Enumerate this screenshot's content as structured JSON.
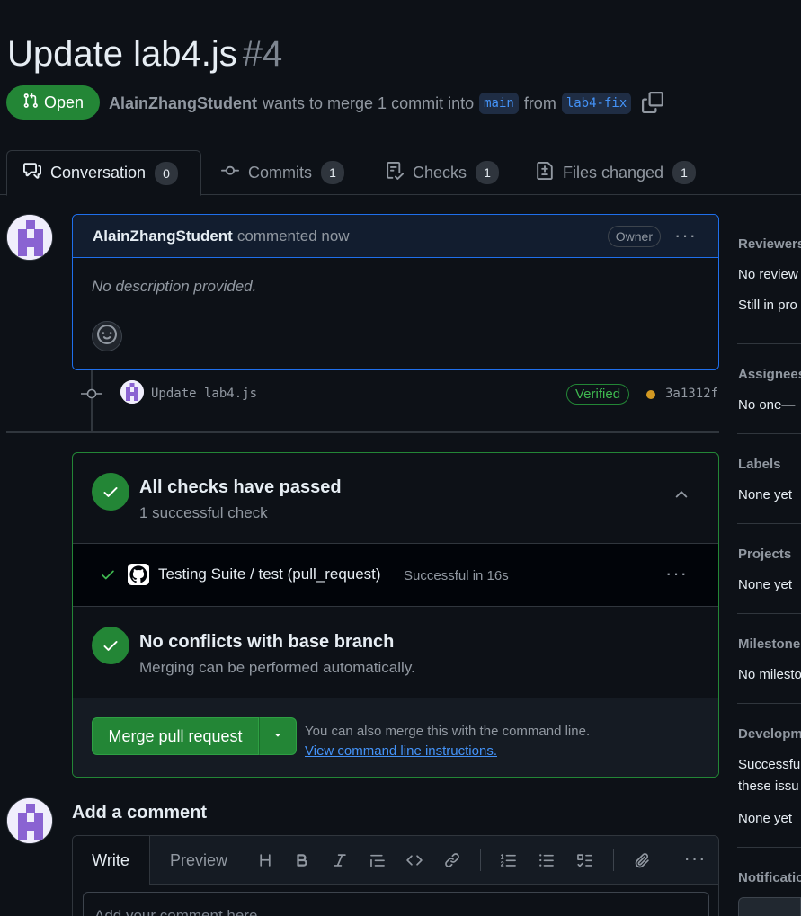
{
  "pr": {
    "title": "Update lab4.js",
    "number": "#4",
    "state": "Open",
    "author": "AlainZhangStudent",
    "merge_text": "wants to merge 1 commit into",
    "base_branch": "main",
    "from_text": "from",
    "head_branch": "lab4-fix"
  },
  "tabs": [
    {
      "label": "Conversation",
      "count": "0"
    },
    {
      "label": "Commits",
      "count": "1"
    },
    {
      "label": "Checks",
      "count": "1"
    },
    {
      "label": "Files changed",
      "count": "1"
    }
  ],
  "comment": {
    "author": "AlainZhangStudent",
    "action": "commented now",
    "badge": "Owner",
    "body": "No description provided."
  },
  "commit": {
    "message": "Update lab4.js",
    "verified": "Verified",
    "sha": "3a1312f"
  },
  "checks": {
    "title": "All checks have passed",
    "subtitle": "1 successful check",
    "item_name": "Testing Suite / test (pull_request)",
    "item_status": "Successful in 16s"
  },
  "conflicts": {
    "title": "No conflicts with base branch",
    "subtitle": "Merging can be performed automatically."
  },
  "merge": {
    "button": "Merge pull request",
    "hint": "You can also merge this with the command line.",
    "link": "View command line instructions."
  },
  "add_comment": {
    "title": "Add a comment",
    "tab_write": "Write",
    "tab_preview": "Preview",
    "placeholder": "Add your comment here..."
  },
  "sidebar": {
    "reviewers_label": "Reviewers",
    "reviewers_value": "No review",
    "reviewers_value2": "Still in pro",
    "assignees_label": "Assignees",
    "assignees_value": "No one—",
    "labels_label": "Labels",
    "labels_value": "None yet",
    "projects_label": "Projects",
    "projects_value": "None yet",
    "milestone_label": "Milestone",
    "milestone_value": "No milesto",
    "development_label": "Developm",
    "development_value": "Successful",
    "development_value2": "these issu",
    "development_value3": "None yet",
    "notifications_label": "Notificatio"
  },
  "colors": {
    "background": "#0d1117",
    "open_green": "#238636",
    "link_blue": "#4493f8",
    "muted": "#9198a1"
  }
}
